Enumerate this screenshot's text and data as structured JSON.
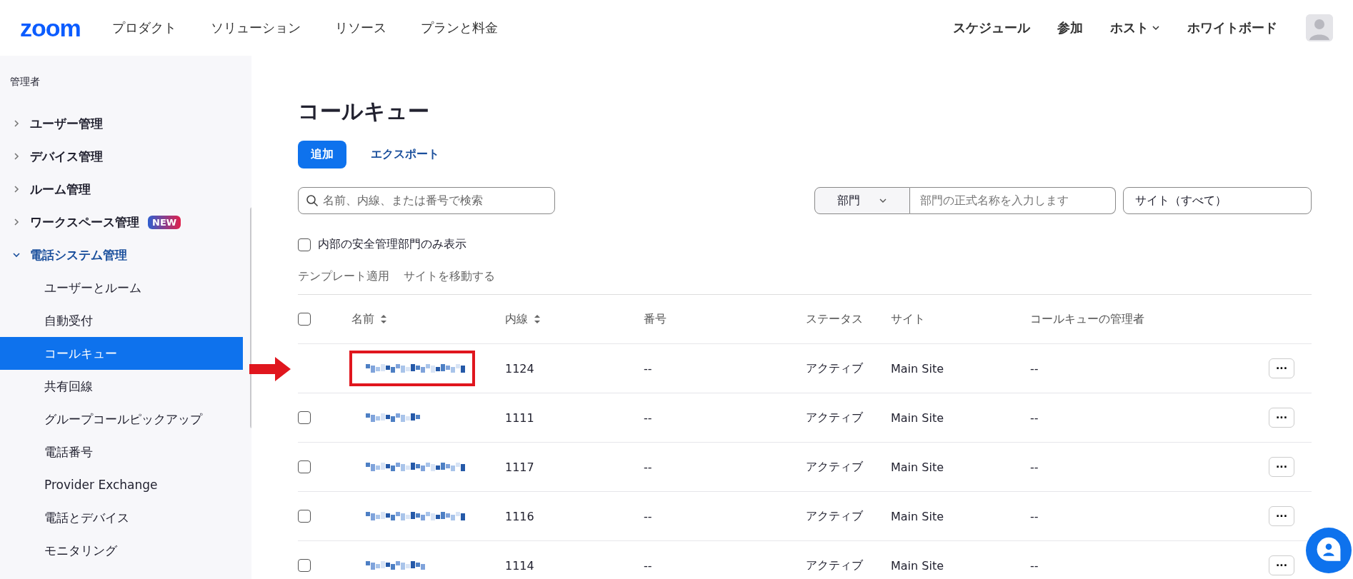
{
  "header": {
    "logo": "zoom",
    "nav": [
      "プロダクト",
      "ソリューション",
      "リソース",
      "プランと料金"
    ],
    "right_nav": [
      {
        "label": "スケジュール",
        "dropdown": false
      },
      {
        "label": "参加",
        "dropdown": false
      },
      {
        "label": "ホスト",
        "dropdown": true
      },
      {
        "label": "ホワイトボード",
        "dropdown": false
      }
    ]
  },
  "sidebar": {
    "section": "管理者",
    "items": [
      {
        "label": "ユーザー管理",
        "expanded": false
      },
      {
        "label": "デバイス管理",
        "expanded": false
      },
      {
        "label": "ルーム管理",
        "expanded": false
      },
      {
        "label": "ワークスペース管理",
        "expanded": false,
        "badge": "NEW"
      },
      {
        "label": "電話システム管理",
        "expanded": true,
        "children": [
          {
            "label": "ユーザーとルーム",
            "selected": false
          },
          {
            "label": "自動受付",
            "selected": false
          },
          {
            "label": "コールキュー",
            "selected": true
          },
          {
            "label": "共有回線",
            "selected": false
          },
          {
            "label": "グループコールピックアップ",
            "selected": false
          },
          {
            "label": "電話番号",
            "selected": false
          },
          {
            "label": "Provider Exchange",
            "selected": false
          },
          {
            "label": "電話とデバイス",
            "selected": false
          },
          {
            "label": "モニタリング",
            "selected": false
          }
        ]
      }
    ]
  },
  "page": {
    "title": "コールキュー",
    "buttons": [
      "追加",
      "エクスポート"
    ],
    "search": {
      "placeholder": "名前、内線、または番号で検索"
    },
    "filter": {
      "dropdown": "部門",
      "placeholder": "部門の正式名称を入力します",
      "site": "サイト（すべて）"
    },
    "internal_only": {
      "label": "内部の安全管理部門のみ表示",
      "checked": false
    },
    "actions": [
      "テンプレート適用",
      "サイトを移動する"
    ],
    "table": {
      "select_all_checked": false,
      "columns": [
        {
          "label": "名前",
          "sortable": true
        },
        {
          "label": "内線",
          "sortable": true
        },
        {
          "label": "番号",
          "sortable": false
        },
        {
          "label": "ステータス",
          "sortable": false
        },
        {
          "label": "サイト",
          "sortable": false
        },
        {
          "label": "コールキューの管理者",
          "sortable": false
        }
      ],
      "rows": [
        {
          "extension": "1124",
          "number": "--",
          "status": "アクティブ",
          "site": "Main Site",
          "managers": "--",
          "more": "···",
          "highlighted": true
        },
        {
          "extension": "1111",
          "number": "--",
          "status": "アクティブ",
          "site": "Main Site",
          "managers": "--",
          "more": "···",
          "highlighted": false,
          "checked": false
        },
        {
          "extension": "1117",
          "number": "--",
          "status": "アクティブ",
          "site": "Main Site",
          "managers": "--",
          "more": "···",
          "highlighted": false,
          "checked": false
        },
        {
          "extension": "1116",
          "number": "--",
          "status": "アクティブ",
          "site": "Main Site",
          "managers": "--",
          "more": "···",
          "highlighted": false,
          "checked": false
        },
        {
          "extension": "1114",
          "number": "--",
          "status": "アクティブ",
          "site": "Main Site",
          "managers": "--",
          "more": "···",
          "highlighted": false,
          "checked": false
        }
      ]
    }
  }
}
